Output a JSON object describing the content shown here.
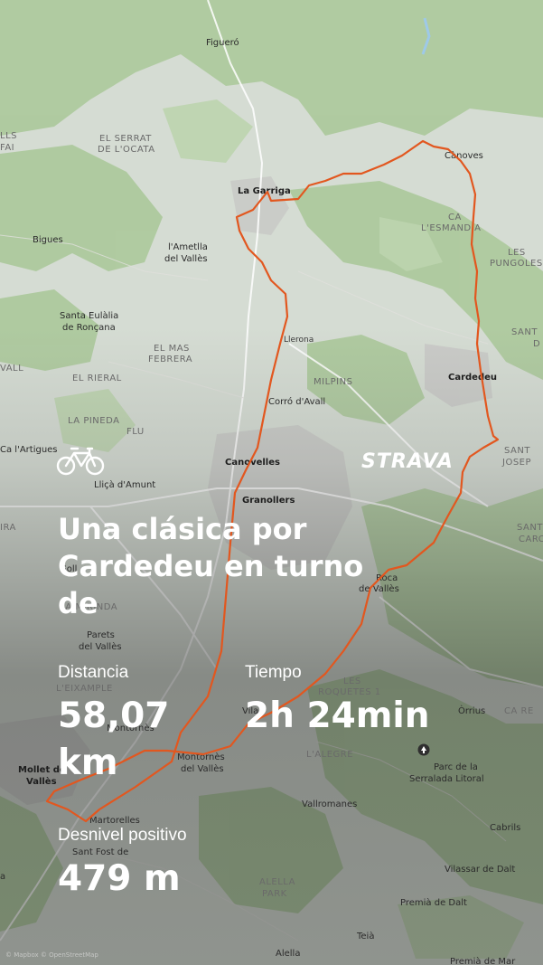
{
  "map": {
    "places": [
      {
        "id": "figuero",
        "text": "Figueró"
      },
      {
        "id": "serrat1",
        "text": "EL SERRAT"
      },
      {
        "id": "serrat2",
        "text": "DE L'OCATA"
      },
      {
        "id": "lagarriga",
        "text": "La Garriga"
      },
      {
        "id": "canoves",
        "text": "Cànoves"
      },
      {
        "id": "esmandia1",
        "text": "CA"
      },
      {
        "id": "esmandia2",
        "text": "L'ESMANDIA"
      },
      {
        "id": "bigues",
        "text": "Bigues"
      },
      {
        "id": "ametlla1",
        "text": "l'Ametlla"
      },
      {
        "id": "ametlla2",
        "text": "del Vallès"
      },
      {
        "id": "pungoles1",
        "text": "LES"
      },
      {
        "id": "pungoles2",
        "text": "PUNGOLES"
      },
      {
        "id": "santaeulalia1",
        "text": "Santa Eulàlia"
      },
      {
        "id": "santaeulalia2",
        "text": "de Ronçana"
      },
      {
        "id": "llerona",
        "text": "Llerona"
      },
      {
        "id": "sant1",
        "text": "SANT"
      },
      {
        "id": "sant2",
        "text": "D"
      },
      {
        "id": "masfebrera1",
        "text": "EL MAS"
      },
      {
        "id": "masfebrera2",
        "text": "FEBRERA"
      },
      {
        "id": "vall",
        "text": "VALL"
      },
      {
        "id": "rieral",
        "text": "EL RIERAL"
      },
      {
        "id": "milpins",
        "text": "MILPINS"
      },
      {
        "id": "cardedeu",
        "text": "Cardedeu"
      },
      {
        "id": "corro",
        "text": "Corró d'Avall"
      },
      {
        "id": "pineda1",
        "text": "LA PINEDA"
      },
      {
        "id": "pineda2",
        "text": "FLU"
      },
      {
        "id": "artigues",
        "text": "Ca l'Artigues"
      },
      {
        "id": "canovelles",
        "text": "Canovelles"
      },
      {
        "id": "santjosep1",
        "text": "SANT"
      },
      {
        "id": "santjosep2",
        "text": "JOSEP"
      },
      {
        "id": "llica",
        "text": "Lliçà d'Amunt"
      },
      {
        "id": "granollers",
        "text": "Granollers"
      },
      {
        "id": "ira",
        "text": "IRA"
      },
      {
        "id": "sant3",
        "text": "SANT"
      },
      {
        "id": "carc",
        "text": "CARC"
      },
      {
        "id": "roca1",
        "text": "Roca"
      },
      {
        "id": "roca2",
        "text": "de Vallès"
      },
      {
        "id": "gollegi",
        "text": "Goll"
      },
      {
        "id": "mirinda",
        "text": "LA MIRINDA"
      },
      {
        "id": "parets1",
        "text": "Parets"
      },
      {
        "id": "parets2",
        "text": "del Vallès"
      },
      {
        "id": "eixample",
        "text": "L'EIXAMPLE"
      },
      {
        "id": "roquetes1",
        "text": "LES"
      },
      {
        "id": "roquetes2",
        "text": "ROQUETES 1"
      },
      {
        "id": "vila",
        "text": "Vila"
      },
      {
        "id": "orrius",
        "text": "Òrrius"
      },
      {
        "id": "carre",
        "text": "CA RE"
      },
      {
        "id": "mollet1",
        "text": "Mollet de"
      },
      {
        "id": "mollet2",
        "text": "Vallès"
      },
      {
        "id": "montornes",
        "text": "Montornès"
      },
      {
        "id": "montornes2",
        "text": "Montornès"
      },
      {
        "id": "montornes3",
        "text": "del Vallès"
      },
      {
        "id": "alegre",
        "text": "L'ALEGRE"
      },
      {
        "id": "parc1",
        "text": "Parc de la"
      },
      {
        "id": "parc2",
        "text": "Serralada Litoral"
      },
      {
        "id": "vallromanes",
        "text": "Vallromanes"
      },
      {
        "id": "martorelles",
        "text": "Martorelles"
      },
      {
        "id": "cabrils",
        "text": "Cabrils"
      },
      {
        "id": "santfost",
        "text": "Sant Fost de"
      },
      {
        "id": "vilassar",
        "text": "Vilassar de Dalt"
      },
      {
        "id": "alella1",
        "text": "ALELLA"
      },
      {
        "id": "alella2",
        "text": "PARK"
      },
      {
        "id": "premia",
        "text": "Premià de Dalt"
      },
      {
        "id": "teia",
        "text": "Teià"
      },
      {
        "id": "alella",
        "text": "Alella"
      },
      {
        "id": "premiamar",
        "text": "Premià de Mar"
      },
      {
        "id": "fai",
        "text": "FAI"
      },
      {
        "id": "lls",
        "text": "LLS"
      },
      {
        "id": "a",
        "text": "a"
      }
    ],
    "credit": "© Mapbox © OpenStreetMap",
    "route_color": "#e2571f"
  },
  "brand": {
    "logo_text": "STRAVA"
  },
  "activity": {
    "icon": "bike-icon",
    "title": "Una clásica por Cardedeu en turno de"
  },
  "stats": {
    "distance_label": "Distancia",
    "distance_value": "58,07 km",
    "time_label": "Tiempo",
    "time_value": "2h 24min",
    "elevation_label": "Desnivel positivo",
    "elevation_value": "479 m"
  }
}
